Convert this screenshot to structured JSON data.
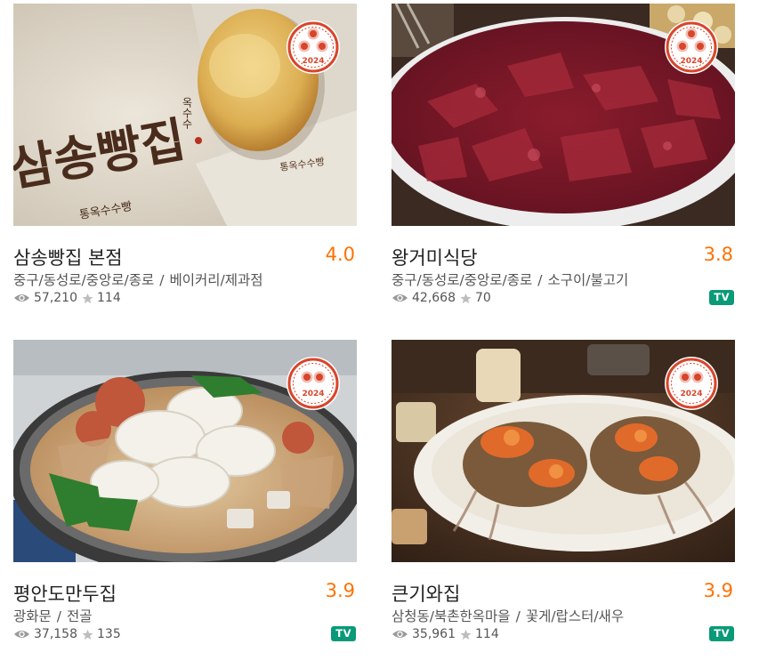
{
  "badge_year": "2024",
  "colors": {
    "rating": "#ff7100",
    "badge_red": "#d8452b",
    "tv_badge": "#0a9a78"
  },
  "icons": {
    "views": "eye-icon",
    "reviews": "star-icon",
    "award": "ribbon-badge-icon"
  },
  "restaurants": [
    {
      "name": "삼송빵집 본점",
      "rating": "4.0",
      "location": "중구/동성로/중앙로/종로",
      "category": "베이커리/제과점",
      "views": "57,210",
      "reviews": "114",
      "tv": ""
    },
    {
      "name": "왕거미식당",
      "rating": "3.8",
      "location": "중구/동성로/중앙로/종로",
      "category": "소구이/불고기",
      "views": "42,668",
      "reviews": "70",
      "tv": "TV"
    },
    {
      "name": "평안도만두집",
      "rating": "3.9",
      "location": "광화문",
      "category": "전골",
      "views": "37,158",
      "reviews": "135",
      "tv": "TV"
    },
    {
      "name": "큰기와집",
      "rating": "3.9",
      "location": "삼청동/북촌한옥마을",
      "category": "꽃게/랍스터/새우",
      "views": "35,961",
      "reviews": "114",
      "tv": "TV"
    }
  ],
  "photo_text": {
    "bag_brand": "삼송빵집",
    "bag_sub": "옥수수",
    "bag_footer": "통옥수수빵",
    "bread_stamp": "통옥수수빵"
  }
}
